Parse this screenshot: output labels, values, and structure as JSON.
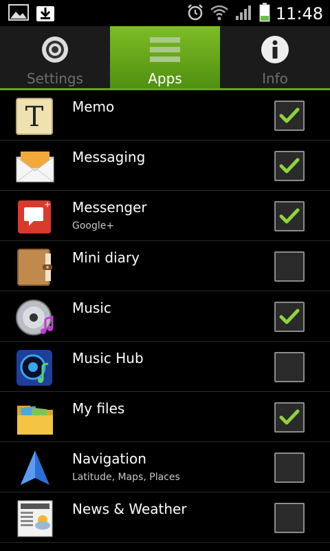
{
  "status": {
    "time": "11:48"
  },
  "tabs": [
    {
      "label": "Settings",
      "icon": "gear-icon",
      "active": false
    },
    {
      "label": "Apps",
      "icon": "list-icon",
      "active": true
    },
    {
      "label": "Info",
      "icon": "info-icon",
      "active": false
    }
  ],
  "apps": [
    {
      "name": "Memo",
      "subtitle": "",
      "checked": true
    },
    {
      "name": "Messaging",
      "subtitle": "",
      "checked": true
    },
    {
      "name": "Messenger",
      "subtitle": "Google+",
      "checked": true
    },
    {
      "name": "Mini diary",
      "subtitle": "",
      "checked": false
    },
    {
      "name": "Music",
      "subtitle": "",
      "checked": true
    },
    {
      "name": "Music Hub",
      "subtitle": "",
      "checked": false
    },
    {
      "name": "My files",
      "subtitle": "",
      "checked": true
    },
    {
      "name": "Navigation",
      "subtitle": "Latitude, Maps, Places",
      "checked": false
    },
    {
      "name": "News & Weather",
      "subtitle": "",
      "checked": false
    }
  ],
  "colors": {
    "accent": "#65a81a",
    "check": "#8fd33a"
  }
}
